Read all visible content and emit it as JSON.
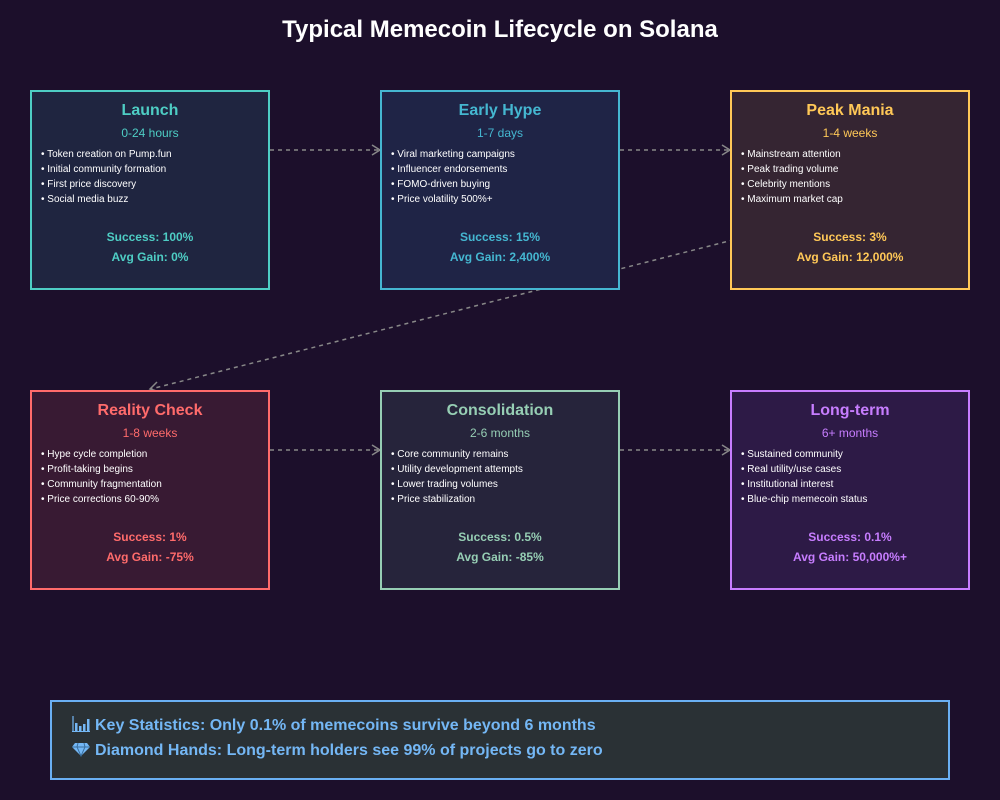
{
  "title": "Typical Memecoin Lifecycle on Solana",
  "colors": {
    "background": "#1c0f2b",
    "connector": "#888888",
    "stats_border": "#6ab0f3",
    "stats_text": "#74b7f5"
  },
  "stages": [
    {
      "name": "Launch",
      "duration": "0-24 hours",
      "bullets": [
        "• Token creation on Pump.fun",
        "• Initial community formation",
        "• First price discovery",
        "• Social media buzz"
      ],
      "success": "Success: 100%",
      "gain": "Avg Gain: 0%",
      "color": "#4ecdc4",
      "fill": "#1f2540"
    },
    {
      "name": "Early Hype",
      "duration": "1-7 days",
      "bullets": [
        "• Viral marketing campaigns",
        "• Influencer endorsements",
        "• FOMO-driven buying",
        "• Price volatility 500%+"
      ],
      "success": "Success: 15%",
      "gain": "Avg Gain: 2,400%",
      "color": "#45b7d1",
      "fill": "#1f2446"
    },
    {
      "name": "Peak Mania",
      "duration": "1-4 weeks",
      "bullets": [
        "• Mainstream attention",
        "• Peak trading volume",
        "• Celebrity mentions",
        "• Maximum market cap"
      ],
      "success": "Success: 3%",
      "gain": "Avg Gain: 12,000%",
      "color": "#ffc857",
      "fill": "#352532"
    },
    {
      "name": "Reality Check",
      "duration": "1-8 weeks",
      "bullets": [
        "• Hype cycle completion",
        "• Profit-taking begins",
        "• Community fragmentation",
        "• Price corrections 60-90%"
      ],
      "success": "Success: 1%",
      "gain": "Avg Gain: -75%",
      "color": "#ff6b6b",
      "fill": "#381a33"
    },
    {
      "name": "Consolidation",
      "duration": "2-6 months",
      "bullets": [
        "• Core community remains",
        "• Utility development attempts",
        "• Lower trading volumes",
        "• Price stabilization"
      ],
      "success": "Success: 0.5%",
      "gain": "Avg Gain: -85%",
      "color": "#96ceb4",
      "fill": "#26243b"
    },
    {
      "name": "Long-term",
      "duration": "6+ months",
      "bullets": [
        "• Sustained community",
        "• Real utility/use cases",
        "• Institutional interest",
        "• Blue-chip memecoin status"
      ],
      "success": "Success: 0.1%",
      "gain": "Avg Gain: 50,000%+",
      "color": "#c77dff",
      "fill": "#2d1a46"
    }
  ],
  "stats": {
    "line1": "Key Statistics: Only 0.1% of memecoins survive beyond 6 months",
    "line1_icon": "bar-chart-icon",
    "line2": "Diamond Hands: Long-term holders see 99% of projects go to zero",
    "line2_icon": "diamond-icon"
  }
}
